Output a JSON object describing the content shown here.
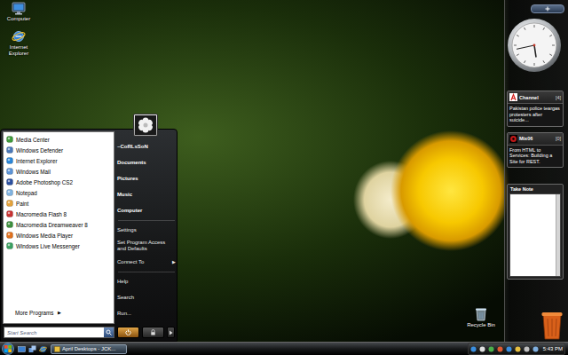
{
  "desktop_icons": [
    {
      "label": "Computer",
      "kind": "computer"
    },
    {
      "label": "Internet Explorer",
      "kind": "browser"
    }
  ],
  "recycle_bin": {
    "label": "Recycle Bin"
  },
  "start_menu": {
    "programs": [
      {
        "label": "Media Center"
      },
      {
        "label": "Windows Defender"
      },
      {
        "label": "Internet Explorer"
      },
      {
        "label": "Windows Mail"
      },
      {
        "label": "Adobe Photoshop CS2"
      },
      {
        "label": "Notepad"
      },
      {
        "label": "Paint"
      },
      {
        "label": "Macromedia Flash 8"
      },
      {
        "label": "Macromedia Dreamweaver 8"
      },
      {
        "label": "Windows Media Player"
      },
      {
        "label": "Windows Live Messenger"
      }
    ],
    "more_programs": {
      "label": "More Programs",
      "arrow": "▶"
    },
    "search": {
      "placeholder": "Start Search"
    },
    "user": {
      "name": "~CoRLsSoN"
    },
    "groups": [
      [
        {
          "label": "Documents"
        },
        {
          "label": "Pictures"
        },
        {
          "label": "Music"
        },
        {
          "label": "Computer"
        }
      ],
      [
        {
          "label": "Settings"
        },
        {
          "label": "Set Program Access and Defaults"
        },
        {
          "label": "Connect To",
          "arrow": "▶"
        }
      ],
      [
        {
          "label": "Help"
        },
        {
          "label": "Search"
        },
        {
          "label": "Run..."
        }
      ]
    ]
  },
  "sidebar": {
    "clock": {
      "hours": 5,
      "minutes": 43
    },
    "feeds": [
      {
        "title": "Channel",
        "count": "[4]",
        "headline": "Pakistan police teargas protesters after suicide...",
        "kind": "letter-logo"
      },
      {
        "title": "Mix06",
        "count": "[0]",
        "headline": "From HTML to Services: Building a Site for REST.",
        "kind": "disc-logo"
      }
    ],
    "note": {
      "title": "Take Note"
    }
  },
  "taskbar": {
    "tasks": [
      {
        "label": "April Desktops - JCK...",
        "selected": true
      }
    ],
    "clock": "5:43 PM"
  }
}
